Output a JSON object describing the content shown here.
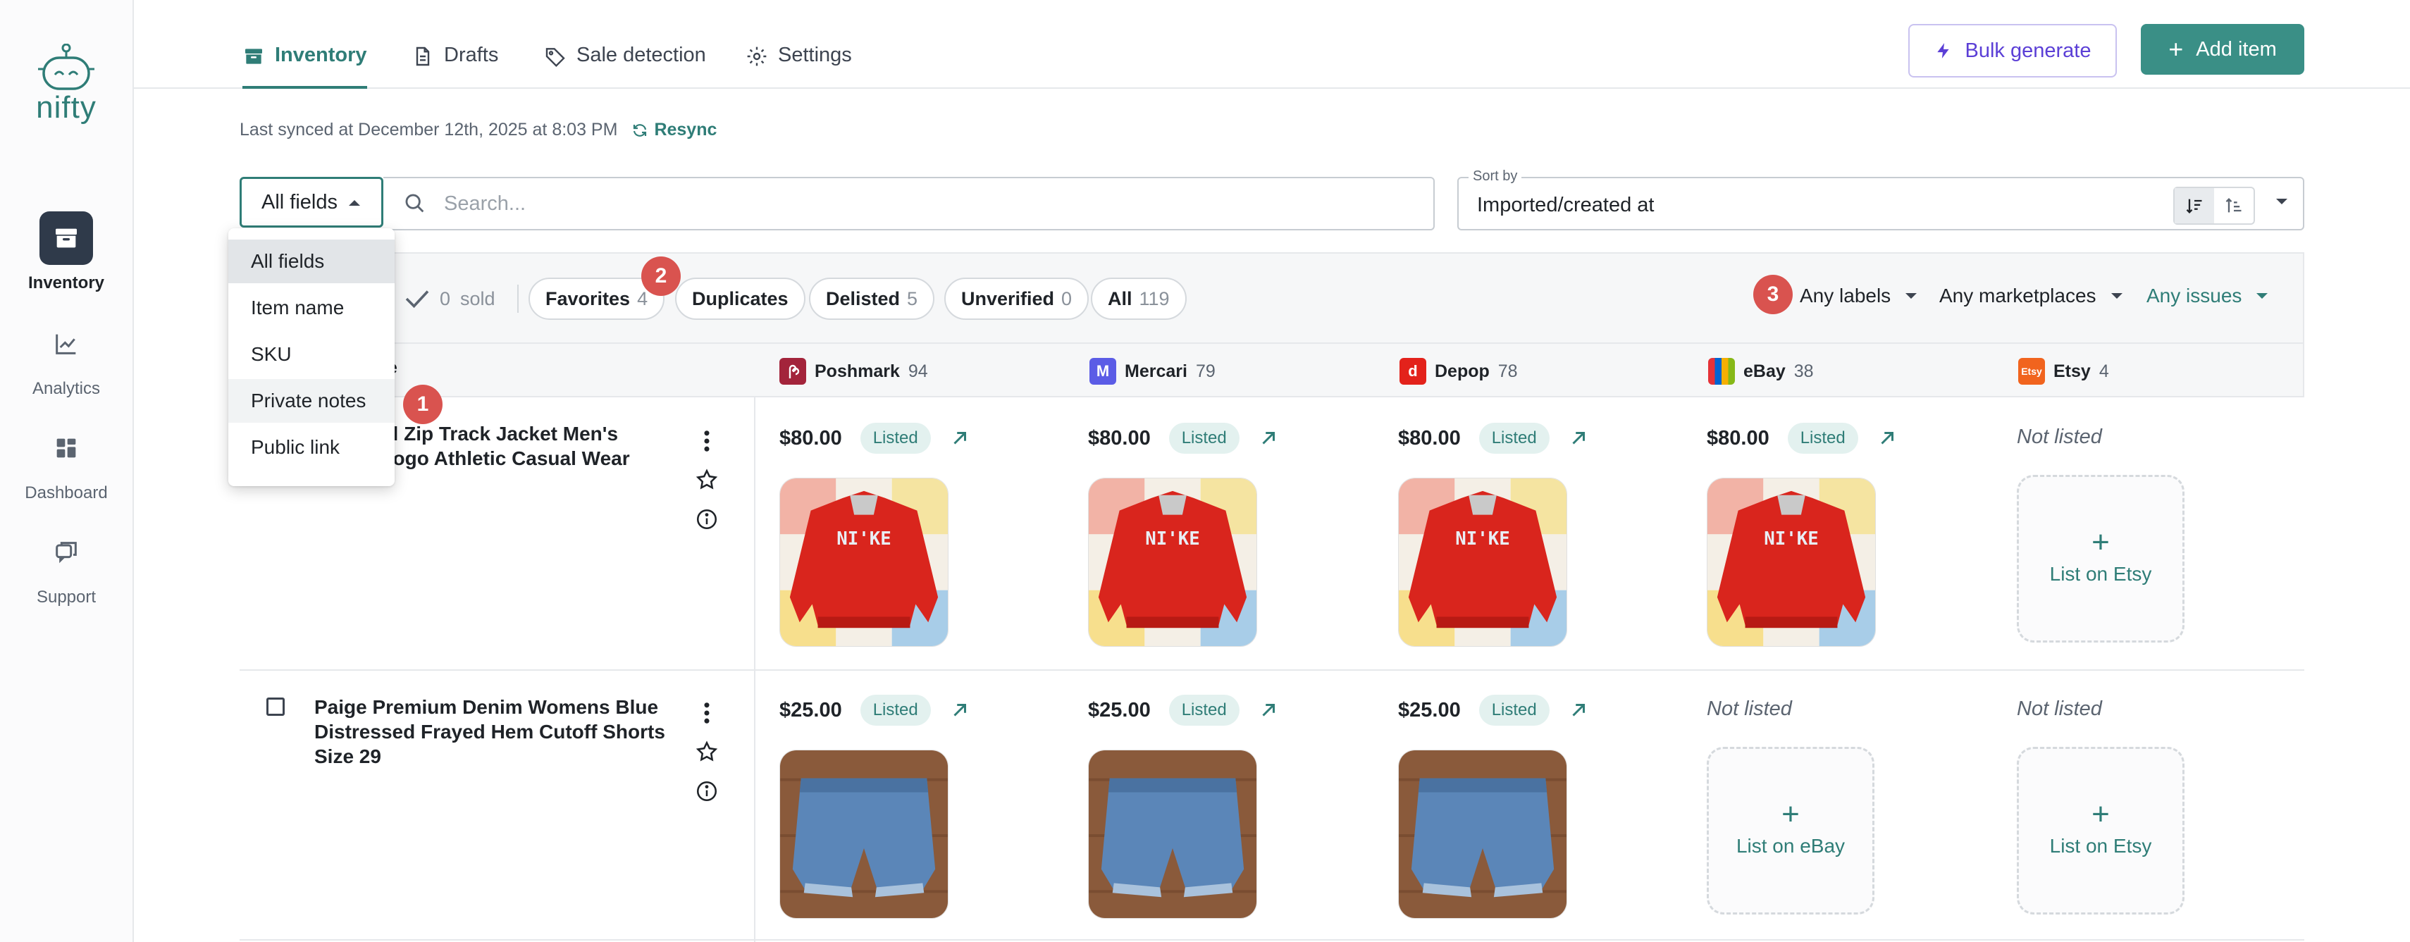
{
  "brand": {
    "name": "nifty"
  },
  "sidebar": {
    "items": [
      {
        "label": "Inventory",
        "icon": "archive-icon"
      },
      {
        "label": "Analytics",
        "icon": "chart-icon"
      },
      {
        "label": "Dashboard",
        "icon": "grid-icon"
      },
      {
        "label": "Support",
        "icon": "chat-icon"
      }
    ]
  },
  "tabs": [
    {
      "label": "Inventory"
    },
    {
      "label": "Drafts"
    },
    {
      "label": "Sale detection"
    },
    {
      "label": "Settings"
    }
  ],
  "header": {
    "bulk_generate": "Bulk generate",
    "add_item": "Add item"
  },
  "sync": {
    "text": "Last synced at December 12th, 2025 at 8:03 PM",
    "resync": "Resync"
  },
  "search": {
    "field": "All fields",
    "placeholder": "Search..."
  },
  "sort": {
    "legend": "Sort by",
    "value": "Imported/created at"
  },
  "field_menu": {
    "options": [
      "All fields",
      "Item name",
      "SKU",
      "Private notes",
      "Public link"
    ],
    "selected": "All fields"
  },
  "filters": {
    "sold": {
      "count": "0",
      "label": "sold"
    },
    "chips": [
      {
        "label": "Favorites",
        "count": "4"
      },
      {
        "label": "Duplicates",
        "count": ""
      },
      {
        "label": "Delisted",
        "count": "5"
      },
      {
        "label": "Unverified",
        "count": "0"
      },
      {
        "label": "All",
        "count": "119"
      }
    ],
    "dropdowns": {
      "labels": "Any labels",
      "marketplaces": "Any marketplaces",
      "issues": "Any issues"
    }
  },
  "badges": [
    "1",
    "2",
    "3"
  ],
  "table": {
    "name_header_fragment": "e",
    "marketplaces": [
      {
        "name": "Poshmark",
        "count": "94",
        "color": "#a3243b"
      },
      {
        "name": "Mercari",
        "count": "79",
        "color": "#5b5ce6"
      },
      {
        "name": "Depop",
        "count": "78",
        "color": "#e3221b"
      },
      {
        "name": "eBay",
        "count": "38",
        "color": "#3265d1"
      },
      {
        "name": "Etsy",
        "count": "4",
        "color": "#f1641e"
      }
    ],
    "rows": [
      {
        "title_lines": [
          "l Full Zip Track Jacket Men's",
          "ge Logo Athletic Casual Wear"
        ],
        "image": "red-nike-jacket",
        "cells": [
          {
            "price": "$80.00",
            "status": "Listed"
          },
          {
            "price": "$80.00",
            "status": "Listed"
          },
          {
            "price": "$80.00",
            "status": "Listed"
          },
          {
            "price": "$80.00",
            "status": "Listed"
          },
          {
            "status": "Not listed",
            "action": "List on Etsy"
          }
        ]
      },
      {
        "title_lines": [
          "Paige Premium Denim Womens Blue",
          "Distressed Frayed Hem Cutoff Shorts",
          "Size 29"
        ],
        "image": "denim-shorts",
        "cells": [
          {
            "price": "$25.00",
            "status": "Listed"
          },
          {
            "price": "$25.00",
            "status": "Listed"
          },
          {
            "price": "$25.00",
            "status": "Listed"
          },
          {
            "status": "Not listed",
            "action": "List on eBay"
          },
          {
            "status": "Not listed",
            "action": "List on Etsy"
          }
        ]
      }
    ]
  },
  "colors": {
    "accent": "#2f7d77",
    "primary_button": "#3a8f86",
    "bulk": "#5b3fd6",
    "badge": "#d9534f"
  }
}
